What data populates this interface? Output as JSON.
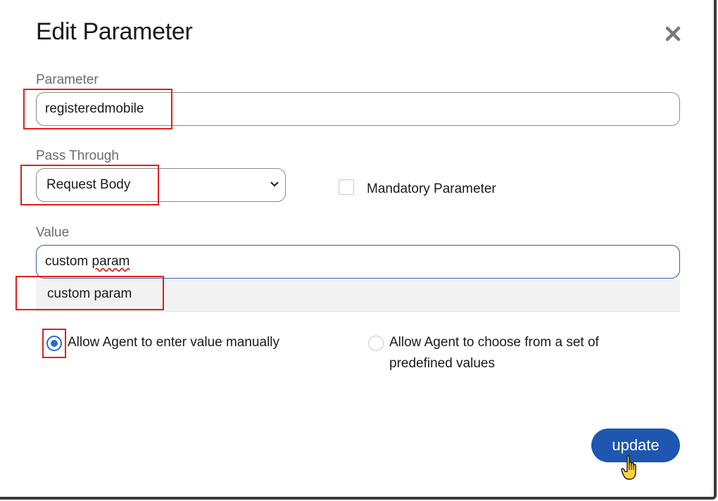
{
  "dialog": {
    "title": "Edit Parameter",
    "close_icon": "close-icon"
  },
  "parameter": {
    "label": "Parameter",
    "value": "registeredmobile"
  },
  "pass_through": {
    "label": "Pass Through",
    "selected": "Request Body"
  },
  "mandatory": {
    "label": "Mandatory Parameter",
    "checked": false
  },
  "value_field": {
    "label": "Value",
    "value_prefix": "custom ",
    "value_misspelled": "param",
    "suggestion": "custom param"
  },
  "options": {
    "manual_label": "Allow Agent to enter value manually",
    "manual_selected": true,
    "predefined_label_line1": "Allow Agent to choose from a set of",
    "predefined_label_line2": "predefined values",
    "predefined_selected": false
  },
  "actions": {
    "update_label": "update"
  },
  "colors": {
    "primary": "#1e56b0",
    "annotation": "#e01e1e",
    "radio_selected": "#2a6ccf"
  }
}
